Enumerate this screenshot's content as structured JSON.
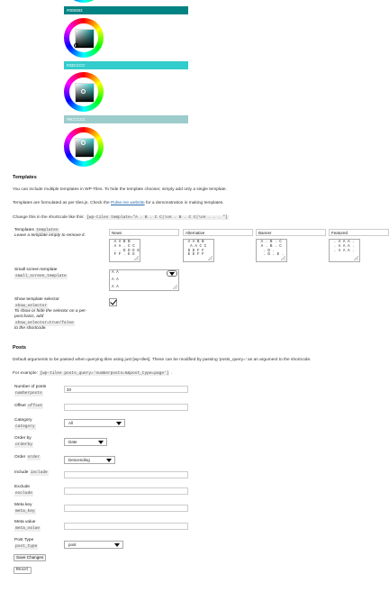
{
  "colors": {
    "swatch1": "#008383",
    "swatch2": "#33CCCC",
    "swatch3": "#9CCCCC",
    "accent_link": "#2b6cb0"
  },
  "color_pickers": [
    {
      "label": "#008383"
    },
    {
      "label": "#33CCCC"
    },
    {
      "label": "#9CCCCC"
    }
  ],
  "templates": {
    "heading": "Templates",
    "p1": "You can include multiple templates in WP-Tiles. To hide the template chooser, simply add only a single template.",
    "p2_pre": "Templates are formulated as per tiles.js.  Check the ",
    "p2_link": "Pulse.me website",
    "p2_post": " for a demonstration in making templates.",
    "p3": "Change this in the shortcode like this:",
    "p3_code": "[wp-tiles template=\"A . B . C C|\\nA . B . C C|\\nA . . . \"]",
    "field_label": "Templates",
    "field_code": "templates",
    "field_help": "Leave a template empty to remove it.",
    "columns": [
      {
        "name": "News",
        "value": " A A B B\n A A . C C\n . . D D E E\n F F . E E"
      },
      {
        "name": "Alternative",
        "value": " A A B B\n  A A C C\n D D F F\n E E F F"
      },
      {
        "name": "Banner",
        "value": " A . B . C\n A . B . C\n  . D .\n  . D . E ."
      },
      {
        "name": "Featured",
        "value": " . A A A .\n . A A A .\n . A A A ."
      }
    ],
    "small_label": "Small screen template",
    "small_code": "small_screen_template",
    "small_value": "A A\n\nA A\n\nA A",
    "selector_label": "Show template selector",
    "selector_code": "show_selector",
    "selector_help1": "To show or hide the selector on a per-",
    "selector_help2": "post basis, add",
    "selector_help_code": "show_selector=true/false",
    "selector_help3": "to the shortcode.",
    "selector_checked": true
  },
  "posts": {
    "heading": "Posts",
    "p1": "Default arguments to be passed when querying tiles using just [wp-tiles]. These can be modified by passing 'posts_query=' as an argument to the shortcode.",
    "example_label": "For example: ",
    "example_code": "[wp-tiles posts_query='numberposts=5&post_type=page']",
    "example_end": " .",
    "fields": {
      "numberposts": {
        "label": "Number of posts",
        "code": "numberposts",
        "value": "20"
      },
      "offset": {
        "label": "Offset",
        "code": "offset",
        "value": ""
      },
      "category": {
        "label": "Category",
        "code": "category",
        "value": "All"
      },
      "orderby": {
        "label": "Order by",
        "code": "orderby",
        "value": "Date"
      },
      "order": {
        "label": "Order",
        "code": "order",
        "value": "Descending"
      },
      "include": {
        "label": "Include",
        "code": "include",
        "value": ""
      },
      "exclude": {
        "label": "Exclude",
        "code": "exclude",
        "value": ""
      },
      "meta_key": {
        "label": "Meta key",
        "code": "meta_key",
        "value": ""
      },
      "meta_value": {
        "label": "Meta value",
        "code": "meta_value",
        "value": ""
      },
      "post_type": {
        "label": "Post Type",
        "code": "post_type",
        "value": "post"
      }
    }
  },
  "buttons": {
    "save": "Save Changes",
    "reset": "Reset"
  }
}
